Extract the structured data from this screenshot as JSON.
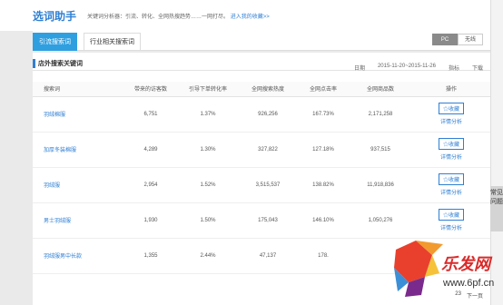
{
  "header": {
    "brand": "选词助手",
    "intro": "关键词分析器：引流、转化、全网热搜趋势……一网打尽。",
    "intro_link": "进入我的收藏>>"
  },
  "tabs": [
    {
      "label": "引流搜索词"
    },
    {
      "label": "行业相关搜索词"
    }
  ],
  "device_toggle": {
    "pc": "PC",
    "wireless": "无线"
  },
  "section": {
    "title": "店外搜索关键词",
    "date_label": "日期",
    "date_range": "2015-11-20~2015-11-26",
    "metric_label": "指标",
    "download_label": "下载"
  },
  "table": {
    "headers": [
      "搜索词",
      "带来的访客数",
      "引导下单转化率",
      "全网搜索热度",
      "全网点击率",
      "全网商品数",
      "操作"
    ],
    "rows": [
      {
        "kw": "羽绒棉服",
        "visitors": "6,751",
        "conv": "1.37%",
        "heat": "926,256",
        "ctr": "167.73%",
        "items": "2,171,258"
      },
      {
        "kw": "加厚冬装棉服",
        "visitors": "4,289",
        "conv": "1.30%",
        "heat": "327,822",
        "ctr": "127.18%",
        "items": "937,515"
      },
      {
        "kw": "羽绒服",
        "visitors": "2,954",
        "conv": "1.52%",
        "heat": "3,515,537",
        "ctr": "138.82%",
        "items": "11,918,836"
      },
      {
        "kw": "男士羽绒服",
        "visitors": "1,930",
        "conv": "1.50%",
        "heat": "175,043",
        "ctr": "146.10%",
        "items": "1,050,276"
      },
      {
        "kw": "羽绒服男中长款",
        "visitors": "1,355",
        "conv": "2.44%",
        "heat": "47,137",
        "ctr": "178.",
        "items": ""
      }
    ],
    "fav_label": "☆收藏",
    "detail_label": "详情分析"
  },
  "sidebar": {
    "qa": "常见问题"
  },
  "pager": {
    "current": "23",
    "next": "下一页"
  },
  "watermark": {
    "text": "乐发网",
    "url": "www.6pf.cn"
  }
}
